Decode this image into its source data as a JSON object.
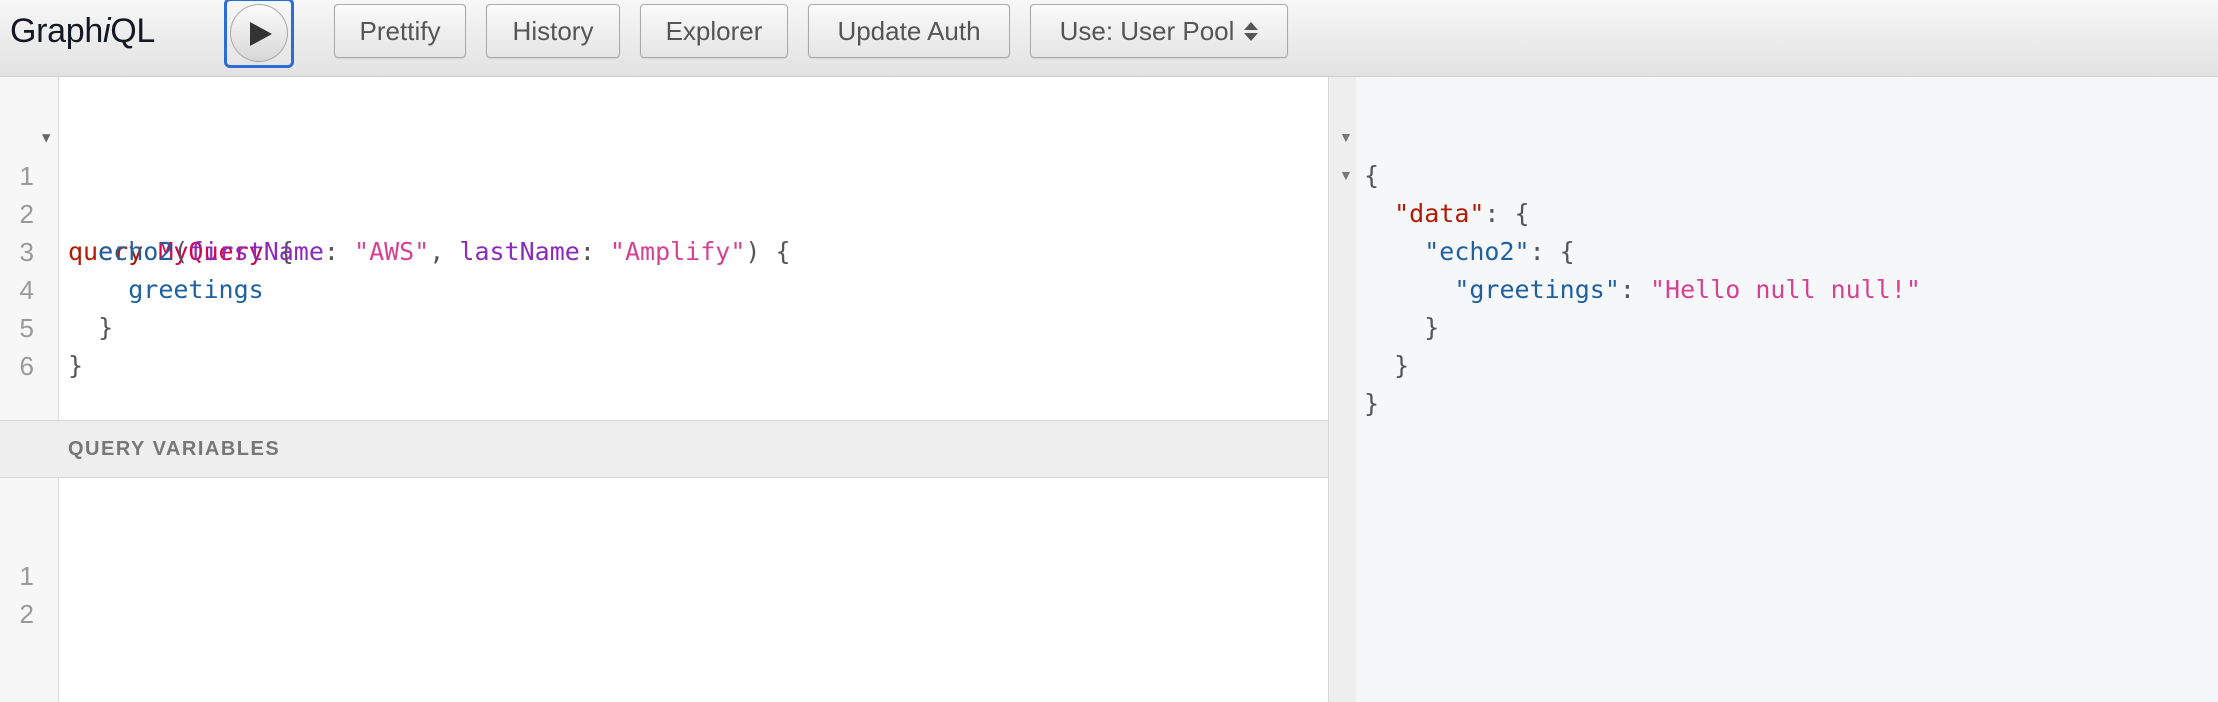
{
  "toolbar": {
    "title_prefix": "Graph",
    "title_italic": "i",
    "title_suffix": "QL",
    "execute_icon": "play-icon",
    "buttons": {
      "prettify": "Prettify",
      "history": "History",
      "explorer": "Explorer",
      "update_auth": "Update Auth"
    },
    "auth_select": {
      "value": "Use: User Pool",
      "icon": "updown-arrows-icon"
    }
  },
  "query_editor": {
    "line_numbers": [
      "1",
      "2",
      "3",
      "4",
      "5",
      "6"
    ],
    "lines": [
      {
        "kw": "query",
        "name": "MyQuery",
        "open": "{"
      },
      {
        "field": "echo2",
        "lp": "(",
        "arg1": "firstName",
        "c1": ": ",
        "v1": "\"AWS\"",
        "sep": ", ",
        "arg2": "lastName",
        "c2": ": ",
        "v2": "\"Amplify\"",
        "rp": ")",
        "open": "{"
      },
      {
        "field": "greetings"
      },
      {
        "close": "}"
      },
      {
        "close": "}"
      },
      {}
    ]
  },
  "variables_panel": {
    "title": "QUERY VARIABLES",
    "line_numbers": [
      "1",
      "2"
    ]
  },
  "result_pane": {
    "lines": [
      {
        "text": "{"
      },
      {
        "key": "\"data\"",
        "rest": ": {"
      },
      {
        "key": "\"echo2\"",
        "rest": ": {"
      },
      {
        "key": "\"greetings\"",
        "colon": ": ",
        "value": "\"Hello null null!\""
      },
      {
        "text": "}"
      },
      {
        "text": "}"
      },
      {
        "text": "}"
      }
    ]
  },
  "colors": {
    "keyword": "#b11a04",
    "definition": "#d2054e",
    "field": "#1f61a0",
    "argument": "#8b2bb9",
    "string": "#d64292",
    "execute_focus": "#2d6cd4"
  }
}
